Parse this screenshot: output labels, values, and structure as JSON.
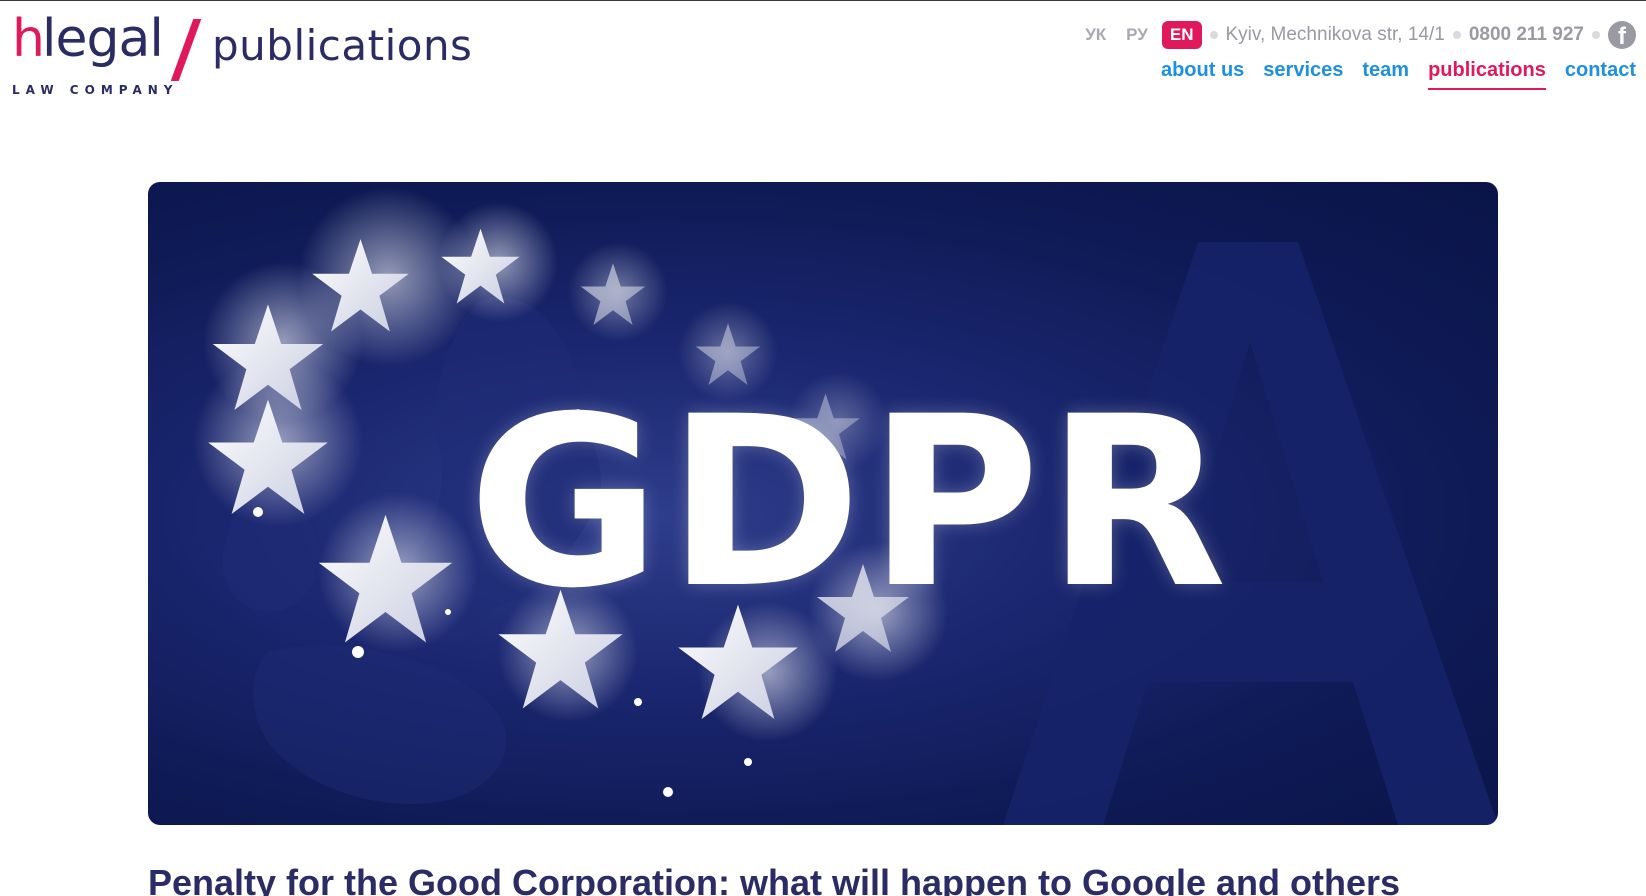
{
  "logo": {
    "h": "h",
    "legal": "legal",
    "section": "publications",
    "subtitle": "LAW COMPANY"
  },
  "languages": [
    {
      "label": "УК",
      "active": false
    },
    {
      "label": "РУ",
      "active": false
    },
    {
      "label": "EN",
      "active": true
    }
  ],
  "contact_bar": {
    "address": "Kyiv, Mechnikova str, 14/1",
    "phone": "0800 211 927",
    "facebook_icon": "f"
  },
  "nav": [
    {
      "label": "about us",
      "active": false
    },
    {
      "label": "services",
      "active": false
    },
    {
      "label": "team",
      "active": false
    },
    {
      "label": "publications",
      "active": true
    },
    {
      "label": "contact",
      "active": false
    }
  ],
  "hero": {
    "text": "GDPR"
  },
  "article": {
    "title": "Penalty for the Good Corporation: what will happen to Google and others"
  },
  "colors": {
    "brand_pink": "#e0195c",
    "brand_navy": "#2b2b66",
    "nav_blue": "#1e90e0",
    "hero_bg": "#0e1a55"
  }
}
